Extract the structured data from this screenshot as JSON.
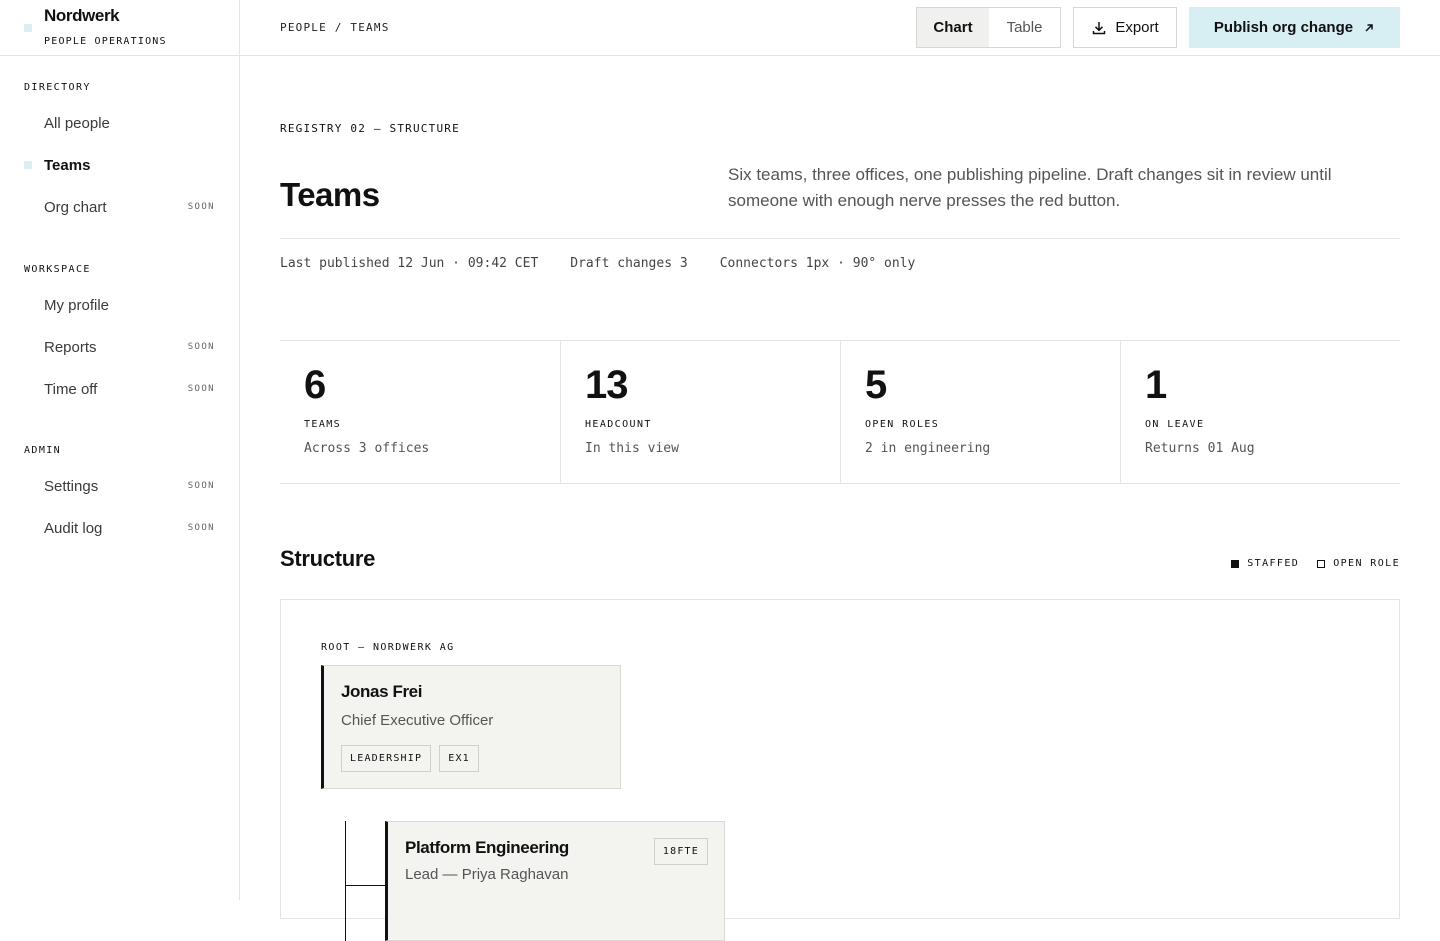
{
  "brand": {
    "name": "Nordwerk",
    "subtitle": "PEOPLE OPERATIONS"
  },
  "sidebar": {
    "sections": [
      {
        "heading": "DIRECTORY",
        "items": [
          {
            "label": "All people",
            "badge": ""
          },
          {
            "label": "Teams",
            "badge": "",
            "active": true
          },
          {
            "label": "Org chart",
            "badge": "SOON"
          }
        ]
      },
      {
        "heading": "WORKSPACE",
        "items": [
          {
            "label": "My profile",
            "badge": ""
          },
          {
            "label": "Reports",
            "badge": "SOON"
          },
          {
            "label": "Time off",
            "badge": "SOON"
          }
        ]
      },
      {
        "heading": "ADMIN",
        "items": [
          {
            "label": "Settings",
            "badge": "SOON"
          },
          {
            "label": "Audit log",
            "badge": "SOON"
          }
        ]
      }
    ]
  },
  "topbar": {
    "breadcrumb": "PEOPLE / TEAMS",
    "view_chart": "Chart",
    "view_table": "Table",
    "export_label": "Export",
    "publish_label": "Publish org change"
  },
  "header": {
    "eyebrow": "REGISTRY 02 — STRUCTURE",
    "title": "Teams",
    "description": "Six teams, three offices, one publishing pipeline. Draft changes sit in review until someone with enough nerve presses the red button.",
    "meta": [
      "Last published 12 Jun · 09:42 CET",
      "Draft changes 3",
      "Connectors 1px · 90° only"
    ]
  },
  "stats": [
    {
      "value": "6",
      "label": "TEAMS",
      "note": "Across 3 offices"
    },
    {
      "value": "13",
      "label": "HEADCOUNT",
      "note": "In this view"
    },
    {
      "value": "5",
      "label": "OPEN ROLES",
      "note": "2 in engineering"
    },
    {
      "value": "1",
      "label": "ON LEAVE",
      "note": "Returns 01 Aug"
    }
  ],
  "structure": {
    "title": "Structure",
    "legend": {
      "staffed": "STAFFED",
      "open_role": "OPEN ROLE"
    },
    "root_label": "ROOT — NORDWERK AG",
    "root": {
      "name": "Jonas Frei",
      "role": "Chief Executive Officer",
      "tags": [
        "LEADERSHIP",
        "EX1"
      ]
    },
    "teams": [
      {
        "name": "Platform Engineering",
        "lead": "Lead — Priya Raghavan",
        "fte": "18FTE"
      }
    ]
  },
  "colors": {
    "accent": "#d7eef3",
    "ink": "#111111",
    "card": "#f3f3f0"
  }
}
